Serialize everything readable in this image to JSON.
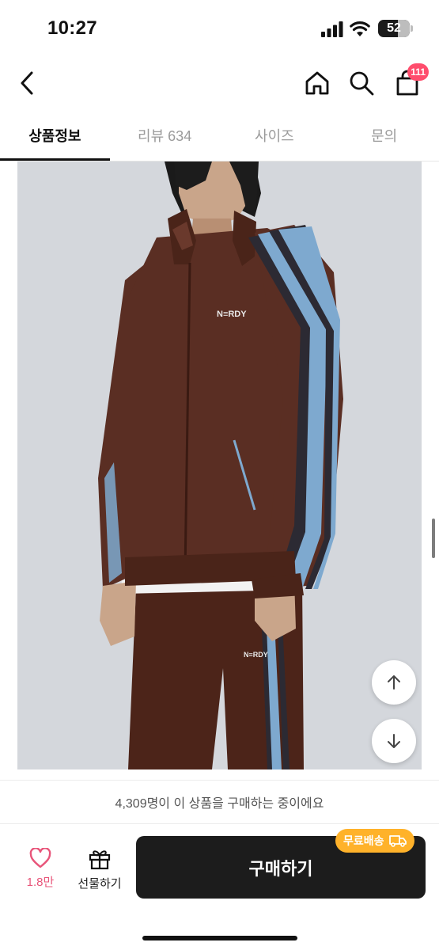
{
  "status_bar": {
    "time": "10:27",
    "battery": "52",
    "icons": [
      "signal-icon",
      "wifi-icon",
      "battery-icon"
    ]
  },
  "nav": {
    "icons": [
      "back-arrow-icon",
      "home-icon",
      "search-icon",
      "shopping-bag-icon"
    ],
    "cart_count": "111"
  },
  "tabs": [
    {
      "label": "상품정보",
      "active": true
    },
    {
      "label": "리뷰 634",
      "active": false
    },
    {
      "label": "사이즈",
      "active": false
    },
    {
      "label": "문의",
      "active": false
    }
  ],
  "product_image": {
    "jacket_logo": "N≡RDY",
    "pants_logo": "N≡RDY",
    "colors": {
      "background": "#d4d7dc",
      "garment": "#5a2e23",
      "stripe_blue": "#7ea9cf",
      "stripe_dark": "#2c2a33"
    }
  },
  "floating_buttons": [
    "arrow-up-icon",
    "arrow-down-icon"
  ],
  "purchase_info": "4,309명이 이 상품을 구매하는 중이에요",
  "bottom_bar": {
    "like_count": "1.8만",
    "gift_label": "선물하기",
    "buy_label": "구매하기",
    "free_shipping_badge": "무료배송",
    "colors": {
      "like": "#e8557a",
      "buy_button": "#1c1c1c",
      "badge": "#ffb22a"
    }
  }
}
